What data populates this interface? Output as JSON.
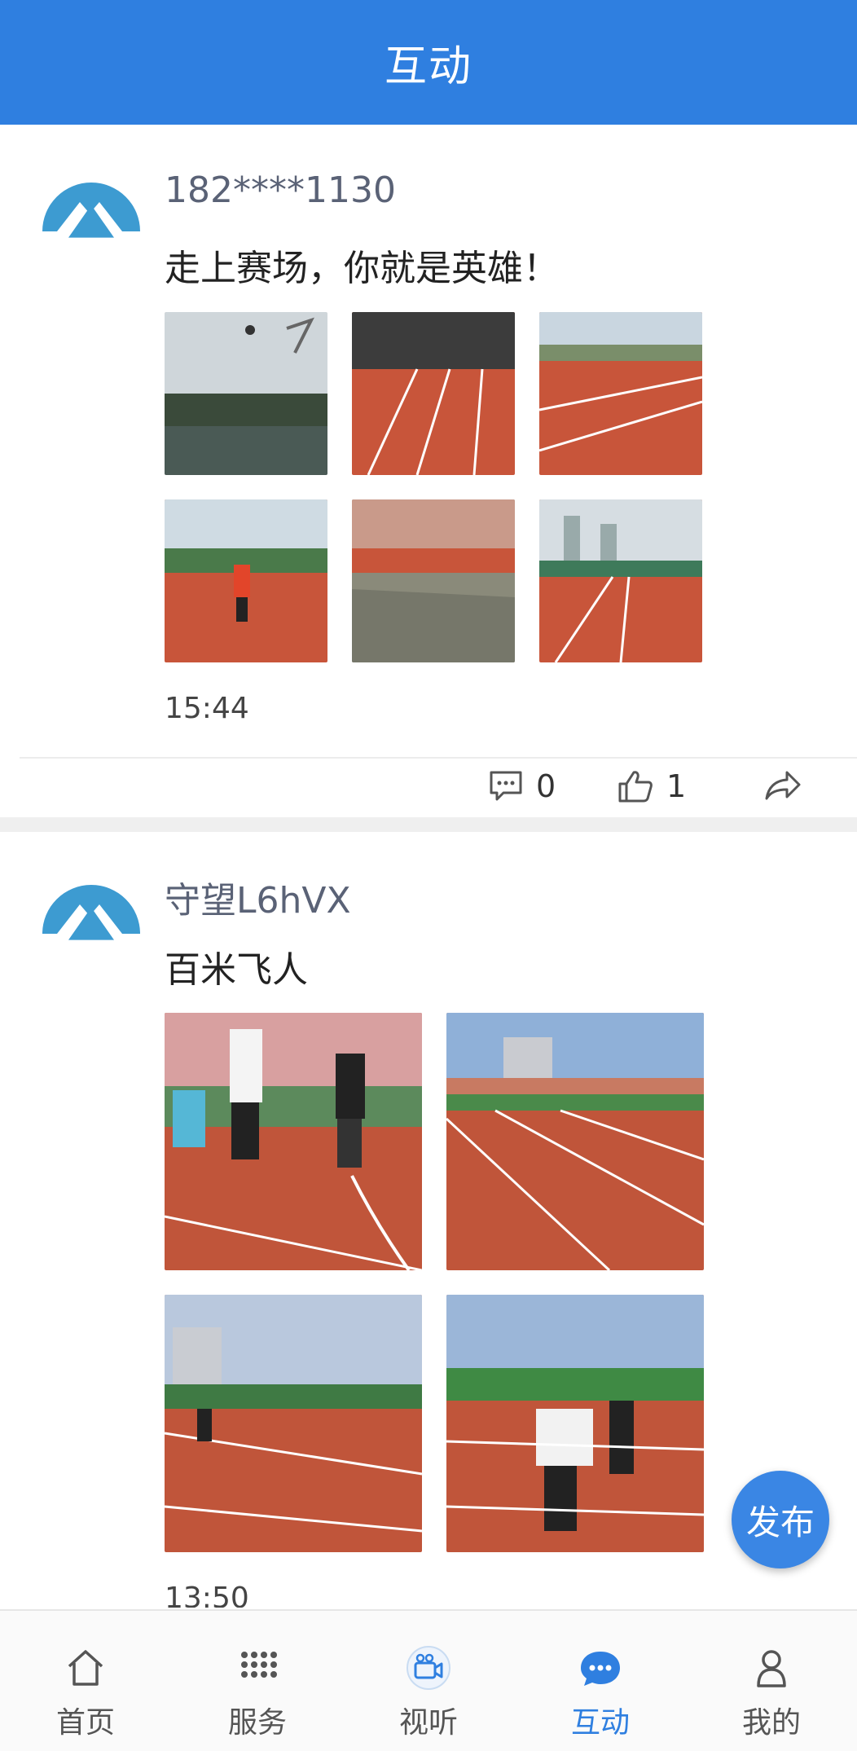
{
  "header": {
    "title": "互动"
  },
  "posts": [
    {
      "username": "182****1130",
      "text": "走上赛场，你就是英雄！",
      "time": "15:44",
      "comments": "0",
      "likes": "1"
    },
    {
      "username": "守望L6hVX",
      "text": "百米飞人",
      "time": "13:50"
    }
  ],
  "fab": {
    "label": "发布"
  },
  "tabbar": {
    "items": [
      {
        "label": "首页",
        "icon": "home-icon"
      },
      {
        "label": "服务",
        "icon": "grid-icon"
      },
      {
        "label": "视听",
        "icon": "camera-icon"
      },
      {
        "label": "互动",
        "icon": "chat-icon",
        "active": true
      },
      {
        "label": "我的",
        "icon": "user-icon"
      }
    ]
  },
  "colors": {
    "brand": "#2f7fe0",
    "track": "#c8553a",
    "avatar": "#3d9bd1"
  }
}
